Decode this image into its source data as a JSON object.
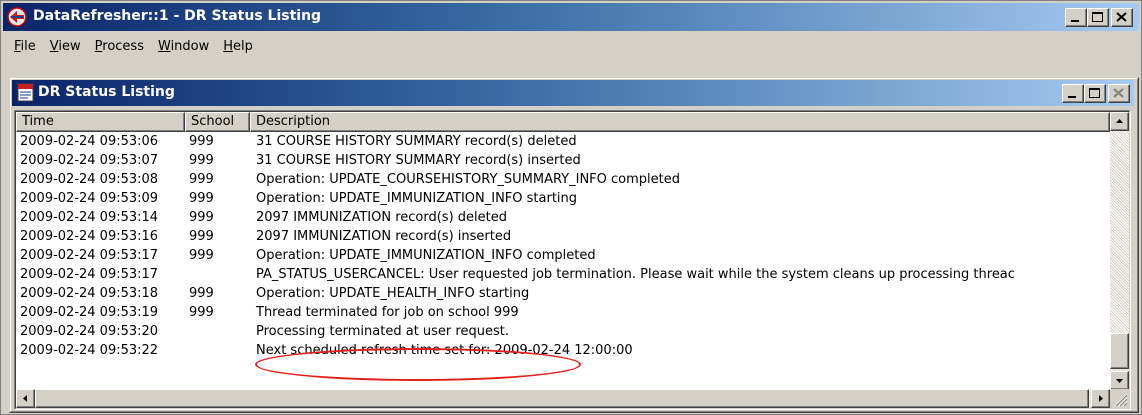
{
  "app": {
    "title": "DataRefresher::1 - DR Status Listing",
    "icon": "app-logo-icon"
  },
  "menu": [
    {
      "label": "File",
      "mnemonic": "F",
      "rest": "ile"
    },
    {
      "label": "View",
      "mnemonic": "V",
      "rest": "iew"
    },
    {
      "label": "Process",
      "mnemonic": "P",
      "rest": "rocess"
    },
    {
      "label": "Window",
      "mnemonic": "W",
      "rest": "indow"
    },
    {
      "label": "Help",
      "mnemonic": "H",
      "rest": "elp"
    }
  ],
  "child": {
    "title": "DR Status Listing",
    "icon": "document-icon"
  },
  "columns": {
    "time": "Time",
    "school": "School",
    "description": "Description"
  },
  "rows": [
    {
      "time": "2009-02-24 09:53:06",
      "school": "999",
      "description": "31 COURSE HISTORY SUMMARY record(s) deleted"
    },
    {
      "time": "2009-02-24 09:53:07",
      "school": "999",
      "description": "31 COURSE HISTORY SUMMARY record(s) inserted"
    },
    {
      "time": "2009-02-24 09:53:08",
      "school": "999",
      "description": "Operation: UPDATE_COURSEHISTORY_SUMMARY_INFO  completed"
    },
    {
      "time": "2009-02-24 09:53:09",
      "school": "999",
      "description": "Operation: UPDATE_IMMUNIZATION_INFO starting"
    },
    {
      "time": "2009-02-24 09:53:14",
      "school": "999",
      "description": "2097 IMMUNIZATION record(s) deleted"
    },
    {
      "time": "2009-02-24 09:53:16",
      "school": "999",
      "description": "2097 IMMUNIZATION record(s) inserted"
    },
    {
      "time": "2009-02-24 09:53:17",
      "school": "999",
      "description": "Operation: UPDATE_IMMUNIZATION_INFO  completed"
    },
    {
      "time": "2009-02-24 09:53:17",
      "school": "",
      "description": "PA_STATUS_USERCANCEL:  User requested job termination.  Please wait while the system cleans up processing threac"
    },
    {
      "time": "2009-02-24 09:53:18",
      "school": "999",
      "description": "Operation: UPDATE_HEALTH_INFO starting"
    },
    {
      "time": "2009-02-24 09:53:19",
      "school": "999",
      "description": "Thread terminated for job on school 999"
    },
    {
      "time": "2009-02-24 09:53:20",
      "school": "",
      "description": "Processing terminated at user request."
    },
    {
      "time": "2009-02-24 09:53:22",
      "school": "",
      "description": "Next scheduled refresh time set for: 2009-02-24 12:00:00"
    }
  ],
  "colors": {
    "titlebar_start": "#0a246a",
    "titlebar_end": "#a6caf0",
    "callout": "#e0201a",
    "face": "#d4d0c8"
  }
}
